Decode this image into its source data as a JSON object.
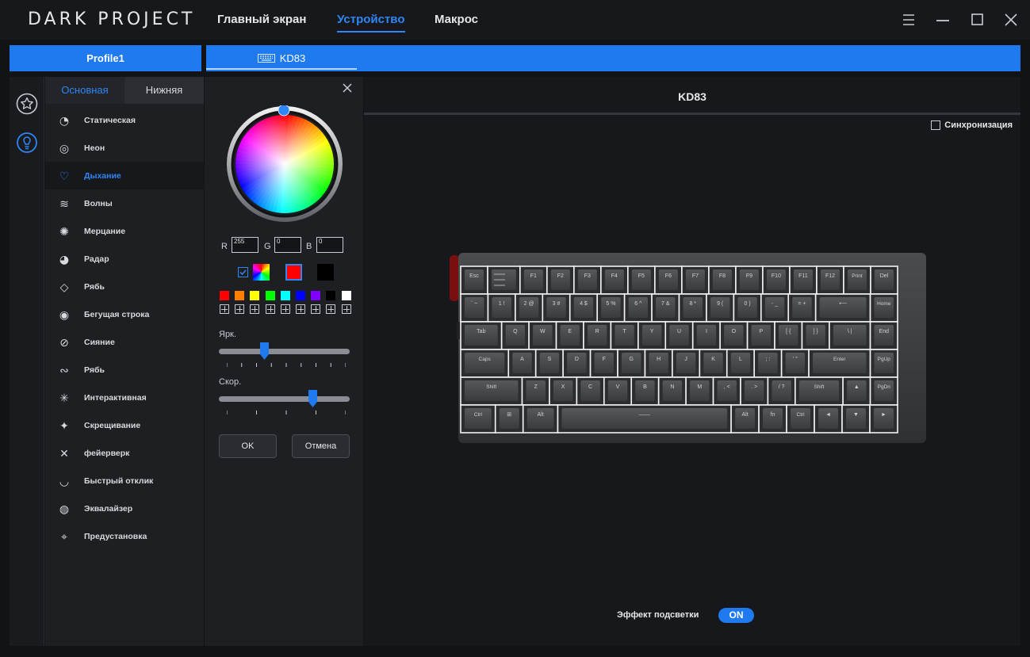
{
  "app": {
    "brand": "DARK PROJECT"
  },
  "nav": {
    "tabs": [
      "Главный экран",
      "Устройство",
      "Макрос"
    ],
    "active": 1
  },
  "window_controls": [
    "menu-icon",
    "minimize-icon",
    "maximize-icon",
    "close-icon"
  ],
  "profile": {
    "name": "Profile1"
  },
  "device": {
    "tab_label": "KD83",
    "title": "KD83"
  },
  "rail_icons": [
    "star-icon",
    "bulb-icon"
  ],
  "effects_panel": {
    "tabs": [
      "Основная",
      "Нижняя"
    ],
    "active_tab": 0,
    "items": [
      {
        "label": "Статическая",
        "icon": "static-icon"
      },
      {
        "label": "Неон",
        "icon": "neon-icon"
      },
      {
        "label": "Дыхание",
        "icon": "breathing-icon"
      },
      {
        "label": "Волны",
        "icon": "waves-icon"
      },
      {
        "label": "Мерцание",
        "icon": "flicker-icon"
      },
      {
        "label": "Радар",
        "icon": "radar-icon"
      },
      {
        "label": "Рябь",
        "icon": "ripple-icon"
      },
      {
        "label": "Бегущая строка",
        "icon": "running-line-icon"
      },
      {
        "label": "Сияние",
        "icon": "glow-icon"
      },
      {
        "label": "Рябь",
        "icon": "ripple2-icon"
      },
      {
        "label": "Интерактивная",
        "icon": "interactive-icon"
      },
      {
        "label": "Скрещивание",
        "icon": "crossing-icon"
      },
      {
        "label": "фейерверк",
        "icon": "firework-icon"
      },
      {
        "label": "Быстрый отклик",
        "icon": "fast-response-icon"
      },
      {
        "label": "Эквалайзер",
        "icon": "equalizer-icon"
      },
      {
        "label": "Предустановка",
        "icon": "preset-icon"
      }
    ],
    "active_index": 2
  },
  "color_panel": {
    "rgb": {
      "r_label": "R",
      "g_label": "G",
      "b_label": "B",
      "r": "255",
      "g": "0",
      "b": "0"
    },
    "rainbow_checked": true,
    "current_color": "#ff0000",
    "secondary_color": "#000000",
    "swatches": [
      "#ff0000",
      "#ff8000",
      "#ffff00",
      "#00ff00",
      "#00ffff",
      "#0000ff",
      "#8000ff",
      "#000000",
      "#ffffff"
    ],
    "brightness": {
      "label": "Ярк.",
      "value": 0.35
    },
    "speed": {
      "label": "Скор.",
      "value": 0.72
    },
    "ok_label": "OK",
    "cancel_label": "Отмена"
  },
  "main": {
    "sync_label": "Синхронизация",
    "sync_checked": false,
    "effect_label": "Эффект подсветки",
    "effect_toggle": "ON",
    "accent": "#1f79ef"
  },
  "keyboard": {
    "rows": [
      [
        "Esc",
        "",
        "F1",
        "F2",
        "F3",
        "F4",
        "F5",
        "F6",
        "F7",
        "F8",
        "F9",
        "F10",
        "F11",
        "F12",
        "Print",
        "Del"
      ],
      [
        "` ~",
        "1 !",
        "2 @",
        "3 #",
        "4 $",
        "5 %",
        "6 ^",
        "7 &",
        "8 *",
        "9 (",
        "0 )",
        "- _",
        "= +",
        "⟵",
        "Home"
      ],
      [
        "Tab",
        "Q",
        "W",
        "E",
        "R",
        "T",
        "Y",
        "U",
        "I",
        "O",
        "P",
        "[ {",
        "] }",
        "\\ |",
        "End"
      ],
      [
        "Caps",
        "A",
        "S",
        "D",
        "F",
        "G",
        "H",
        "J",
        "K",
        "L",
        "; :",
        "' \"",
        "Enter",
        "PgUp"
      ],
      [
        "Shift",
        "Z",
        "X",
        "C",
        "V",
        "B",
        "N",
        "M",
        ", <",
        ". >",
        "/ ?",
        "Shift",
        "▲",
        "PgDn"
      ],
      [
        "Ctrl",
        "⊞",
        "Alt",
        "——",
        "Alt",
        "fn",
        "Ctrl",
        "◄",
        "▼",
        "►"
      ]
    ],
    "row_units": [
      [
        1,
        1.2,
        1,
        1,
        1,
        1,
        1,
        1,
        1,
        1,
        1,
        1,
        1,
        1,
        1,
        1
      ],
      [
        1,
        1,
        1,
        1,
        1,
        1,
        1,
        1,
        1,
        1,
        1,
        1,
        1,
        2,
        1
      ],
      [
        1.5,
        1,
        1,
        1,
        1,
        1,
        1,
        1,
        1,
        1,
        1,
        1,
        1,
        1.5,
        1
      ],
      [
        1.75,
        1,
        1,
        1,
        1,
        1,
        1,
        1,
        1,
        1,
        1,
        1,
        2.25,
        1
      ],
      [
        2.25,
        1,
        1,
        1,
        1,
        1,
        1,
        1,
        1,
        1,
        1,
        1.75,
        1,
        1
      ],
      [
        1.25,
        1,
        1.25,
        6.25,
        1,
        1,
        1,
        1,
        1,
        1
      ]
    ]
  }
}
